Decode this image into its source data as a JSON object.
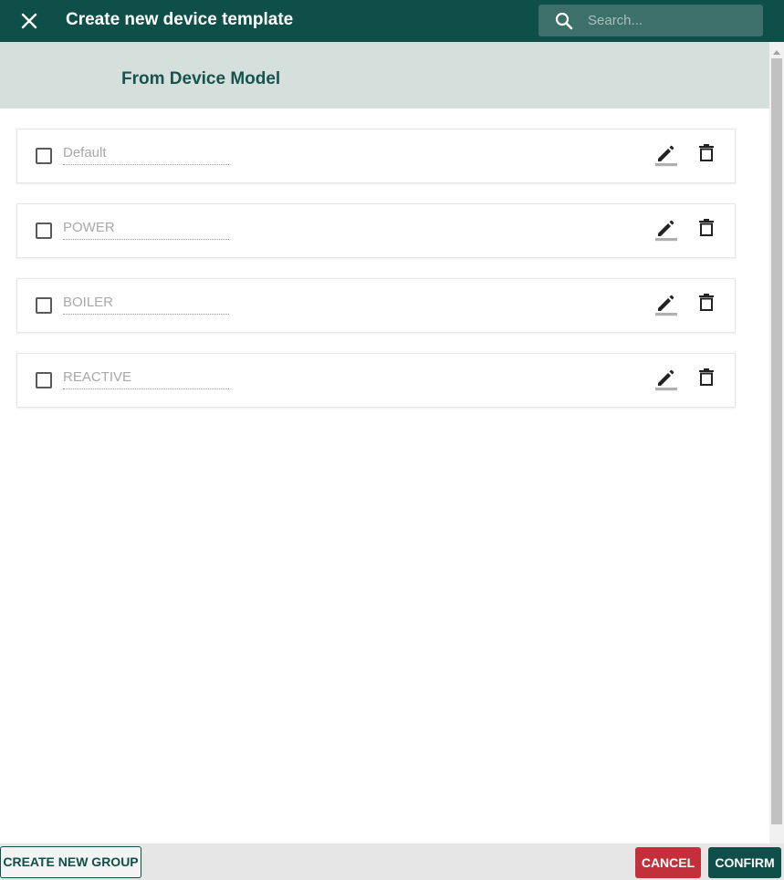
{
  "header": {
    "title": "Create new device template",
    "close_icon": "close-icon",
    "search": {
      "placeholder": "Search...",
      "value": "",
      "icon": "search-icon"
    }
  },
  "section": {
    "title": "From Device Model"
  },
  "groups": [
    {
      "name": "Default",
      "checked": false
    },
    {
      "name": "POWER",
      "checked": false
    },
    {
      "name": "BOILER",
      "checked": false
    },
    {
      "name": "REACTIVE",
      "checked": false
    }
  ],
  "row_icons": {
    "edit": "pencil-edit-icon",
    "delete": "trash-icon"
  },
  "footer": {
    "create_label": "CREATE NEW GROUP",
    "cancel_label": "CANCEL",
    "confirm_label": "CONFIRM"
  },
  "colors": {
    "primary": "#0f4f4a",
    "section_bg": "#d5dfdc",
    "cancel": "#c3303b"
  }
}
